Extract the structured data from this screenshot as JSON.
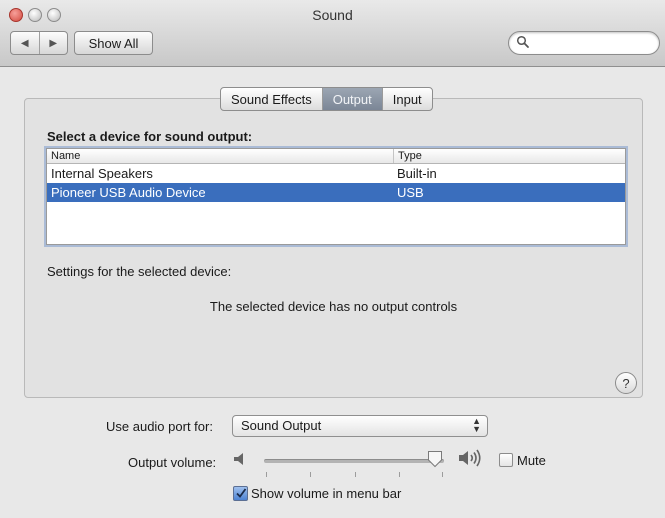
{
  "window": {
    "title": "Sound"
  },
  "toolbar": {
    "back_glyph": "◀",
    "forward_glyph": "▶",
    "show_all_label": "Show All",
    "search": {
      "value": "",
      "placeholder": ""
    }
  },
  "tabs": [
    {
      "label": "Sound Effects",
      "active": false
    },
    {
      "label": "Output",
      "active": true
    },
    {
      "label": "Input",
      "active": false
    }
  ],
  "output": {
    "select_device_label": "Select a device for sound output:",
    "columns": {
      "name": "Name",
      "type": "Type"
    },
    "devices": [
      {
        "name": "Internal Speakers",
        "type": "Built-in",
        "selected": false
      },
      {
        "name": "Pioneer USB Audio Device",
        "type": "USB",
        "selected": true
      }
    ],
    "settings_label": "Settings for the selected device:",
    "no_controls_message": "The selected device has no output controls"
  },
  "help_glyph": "?",
  "bottom": {
    "port_label": "Use audio port for:",
    "port_value": "Sound Output",
    "volume_label": "Output volume:",
    "volume_level": 0.95,
    "mute_label": "Mute",
    "mute_checked": false,
    "menubar_label": "Show volume in menu bar",
    "menubar_checked": true
  },
  "colors": {
    "selection": "#3a6ebd",
    "active_tab": "#7b8696",
    "close_button": "#d24a3f"
  }
}
